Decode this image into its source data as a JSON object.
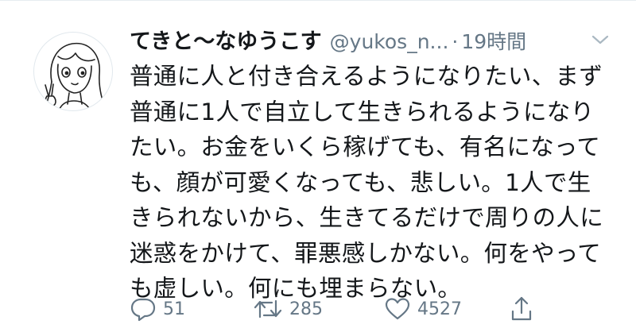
{
  "tweet": {
    "display_name": "てきと〜なゆうこす",
    "handle": "@yukos_n...",
    "separator": "·",
    "time": "19時間",
    "text": "普通に人と付き合えるようになりたい、まず\n普通に1人で自立して生きられるようになり\nたい。お金をいくら稼げても、有名になって\nも、顔が可愛くなっても、悲しい。1人で生\nきられないから、生きてるだけで周りの人に\n迷惑をかけて、罪悪感しかない。何をやって\nも虚しい。何にも埋まらない。"
  },
  "actions": {
    "reply": {
      "icon": "reply-icon",
      "count": "51"
    },
    "retweet": {
      "icon": "retweet-icon",
      "count": "285"
    },
    "like": {
      "icon": "heart-icon",
      "count": "4527"
    },
    "share": {
      "icon": "share-icon"
    }
  },
  "colors": {
    "text": "#14171a",
    "secondary": "#657786",
    "icon": "#657786",
    "divider": "#e6ecf0"
  }
}
